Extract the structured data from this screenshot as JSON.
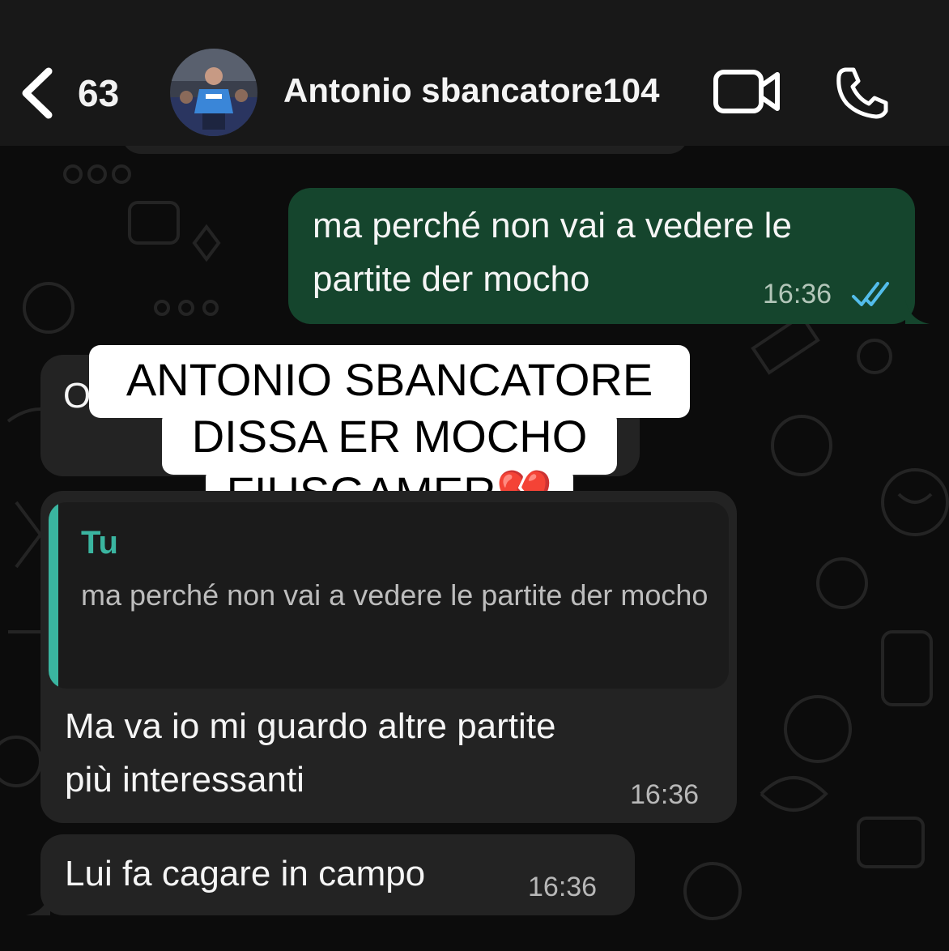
{
  "header": {
    "unread_count": "63",
    "contact_name": "Antonio sbancatore104"
  },
  "messages": [
    {
      "direction": "outgoing",
      "text_line1": "ma perché non vai a vedere le",
      "text_line2": "partite der mocho",
      "time": "16:36",
      "status": "read"
    },
    {
      "direction": "incoming",
      "partial_text": "O",
      "time": ""
    },
    {
      "direction": "incoming",
      "quote_author": "Tu",
      "quote_text": "ma perché non vai a vedere le partite der mocho",
      "text_line1": "Ma va io mi guardo altre partite",
      "text_line2": "più interessanti",
      "time": "16:36"
    },
    {
      "direction": "incoming",
      "text": "Lui fa cagare in campo",
      "time": "16:36"
    }
  ],
  "caption": {
    "line1": "ANTONIO SBANCATORE",
    "line2": "DISSA ER MOCHO",
    "line3": "FIUSGAMER💔"
  },
  "colors": {
    "outgoing_bubble": "#15452d",
    "incoming_bubble": "#232323",
    "quote_accent": "#3ab5a0",
    "read_tick": "#53bdeb"
  }
}
